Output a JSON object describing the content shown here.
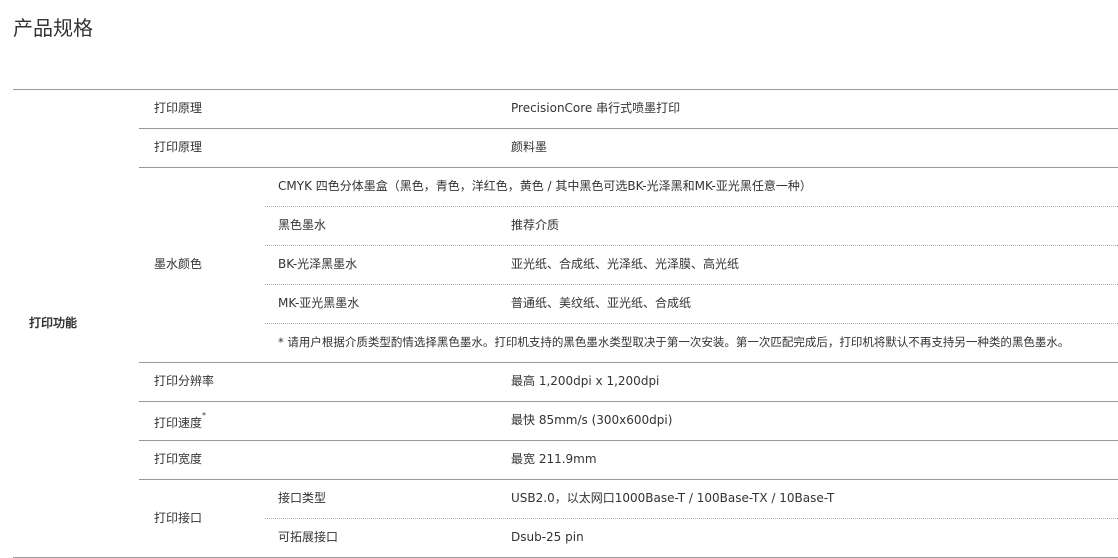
{
  "page_title": "产品规格",
  "category": "打印功能",
  "rows": [
    {
      "label": "打印原理",
      "value": "PrecisionCore 串行式喷墨打印"
    },
    {
      "label": "打印原理",
      "value": "颜料墨"
    },
    {
      "label": "墨水颜色",
      "ink_set": "CMYK 四色分体墨盒（黑色，青色，洋红色，黄色 / 其中黑色可选BK-光泽黑和MK-亚光黑任意一种）",
      "black_ink_header": "黑色墨水",
      "media_header": "推荐介质",
      "bk_name": "BK-光泽黑墨水",
      "bk_media": "亚光纸、合成纸、光泽纸、光泽膜、高光纸",
      "mk_name": "MK-亚光黑墨水",
      "mk_media": "普通纸、美纹纸、亚光纸、合成纸",
      "note": "* 请用户根据介质类型酌情选择黑色墨水。打印机支持的黑色墨水类型取决于第一次安装。第一次匹配完成后，打印机将默认不再支持另一种类的黑色墨水。"
    },
    {
      "label": "打印分辨率",
      "value": "最高 1,200dpi x 1,200dpi"
    },
    {
      "label": "打印速度",
      "label_sup": "*",
      "value": "最快 85mm/s (300x600dpi)"
    },
    {
      "label": "打印宽度",
      "value": "最宽 211.9mm"
    },
    {
      "label": "打印接口",
      "sub1_label": "接口类型",
      "sub1_value": "USB2.0，以太网口1000Base-T / 100Base-TX / 10Base-T",
      "sub2_label": "可拓展接口",
      "sub2_value": "Dsub-25 pin"
    }
  ]
}
